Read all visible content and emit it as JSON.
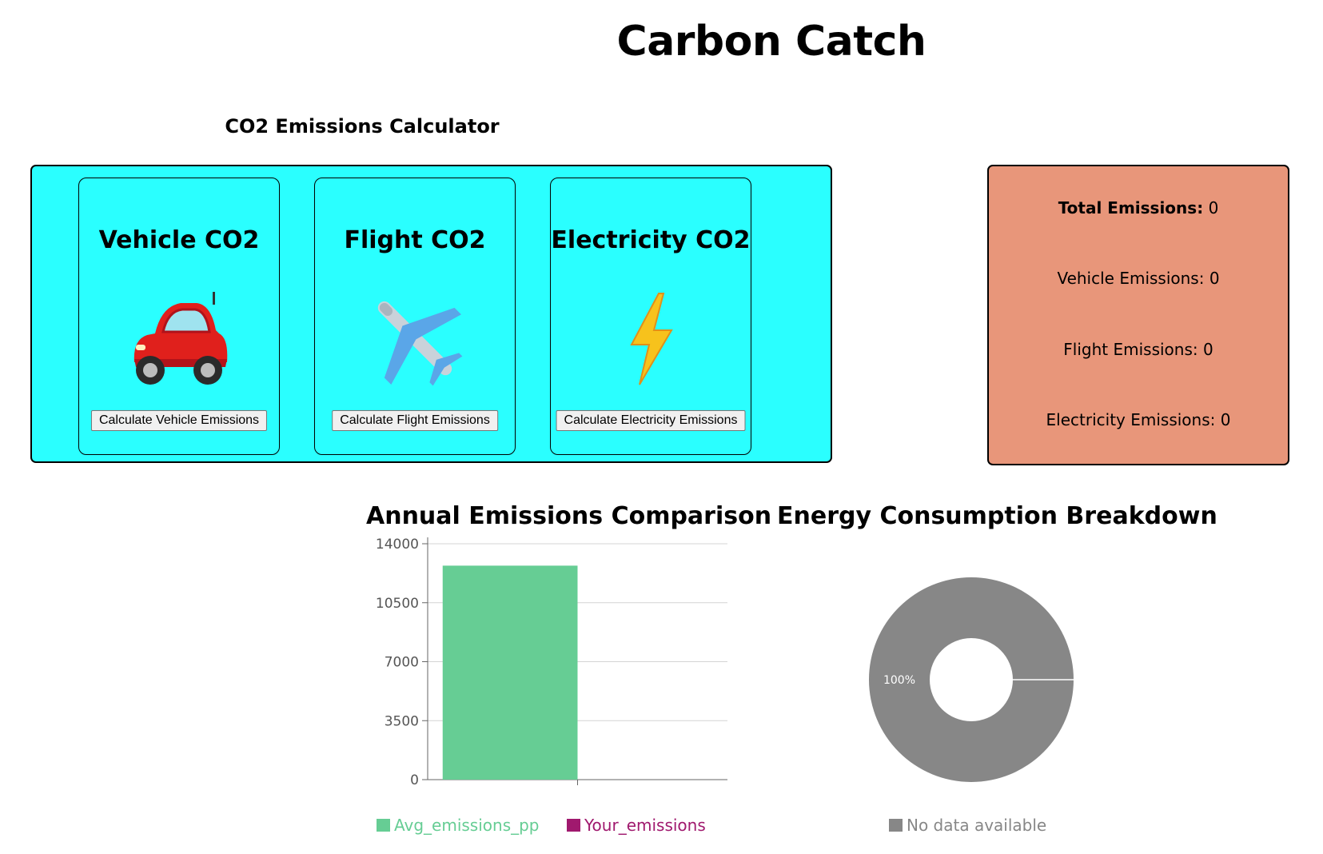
{
  "app": {
    "title": "Carbon Catch"
  },
  "calculator": {
    "title": "CO2 Emissions Calculator",
    "cards": [
      {
        "title": "Vehicle CO2",
        "icon": "car-icon",
        "button": "Calculate Vehicle Emissions"
      },
      {
        "title": "Flight CO2",
        "icon": "airplane-icon",
        "button": "Calculate Flight Emissions"
      },
      {
        "title": "Electricity CO2",
        "icon": "lightning-icon",
        "button": "Calculate Electricity Emissions"
      }
    ]
  },
  "totals": {
    "total_label": "Total Emissions:",
    "total_value": "0",
    "vehicle": "Vehicle Emissions: 0",
    "flight": "Flight Emissions: 0",
    "electricity": "Electricity Emissions: 0"
  },
  "colors": {
    "calc_panel_bg": "#2affff",
    "totals_panel_bg": "#e8967a",
    "avg_series": "#66cd94",
    "your_series": "#a0196e",
    "no_data": "#878787"
  },
  "chart_data": [
    {
      "type": "bar",
      "title": "Annual Emissions Comparison",
      "categories": [
        ""
      ],
      "series": [
        {
          "name": "Avg_emissions_pp",
          "values": [
            12700
          ]
        },
        {
          "name": "Your_emissions",
          "values": [
            0
          ]
        }
      ],
      "ylim": [
        0,
        14000
      ],
      "yticks": [
        0,
        3500,
        7000,
        10500,
        14000
      ],
      "grid": true,
      "legend": "bottom"
    },
    {
      "type": "pie",
      "title": "Energy Consumption Breakdown",
      "slices": [
        {
          "label": "No data available",
          "value": 100,
          "display": "100%"
        }
      ],
      "legend": "bottom"
    }
  ]
}
